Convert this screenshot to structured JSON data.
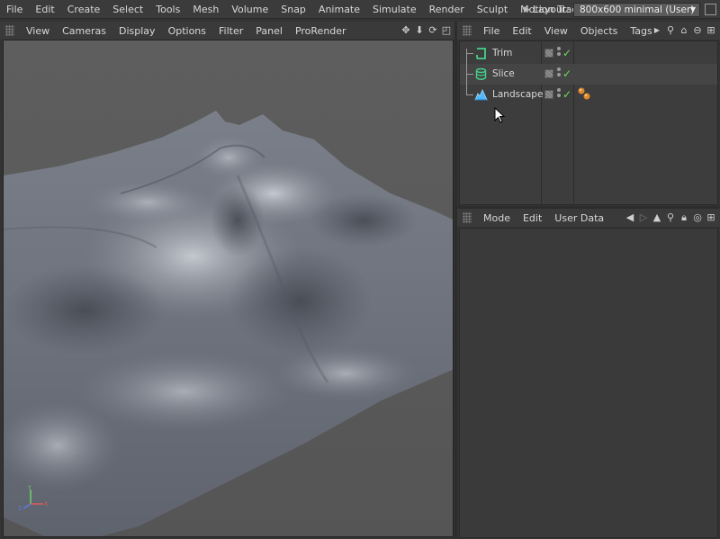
{
  "menubar": {
    "items": [
      "File",
      "Edit",
      "Create",
      "Select",
      "Tools",
      "Mesh",
      "Volume",
      "Snap",
      "Animate",
      "Simulate",
      "Render",
      "Sculpt",
      "Motion Tracker"
    ],
    "layout_label": "Layout:",
    "layout_value": "800x600 minimal (User)"
  },
  "viewport": {
    "menu": [
      "View",
      "Cameras",
      "Display",
      "Options",
      "Filter",
      "Panel",
      "ProRender"
    ],
    "tool_icons": [
      "move-view-icon",
      "zoom-view-icon",
      "rotate-view-icon",
      "maximize-view-icon"
    ]
  },
  "object_manager": {
    "menu": [
      "File",
      "Edit",
      "View",
      "Objects",
      "Tags"
    ],
    "objects": [
      {
        "name": "Trim",
        "icon": "trim-icon",
        "enabled": true,
        "tag": ""
      },
      {
        "name": "Slice",
        "icon": "slice-icon",
        "enabled": true,
        "tag": ""
      },
      {
        "name": "Landscape",
        "icon": "landscape-icon",
        "enabled": true,
        "tag": "material-tag-icon"
      }
    ]
  },
  "attribute_manager": {
    "menu": [
      "Mode",
      "Edit",
      "User Data"
    ]
  },
  "colors": {
    "accent_check": "#6fdc5b",
    "trim_icon": "#45d08a",
    "landscape_icon": "#4fb6ff",
    "tag_orange": "#e08a2a"
  }
}
